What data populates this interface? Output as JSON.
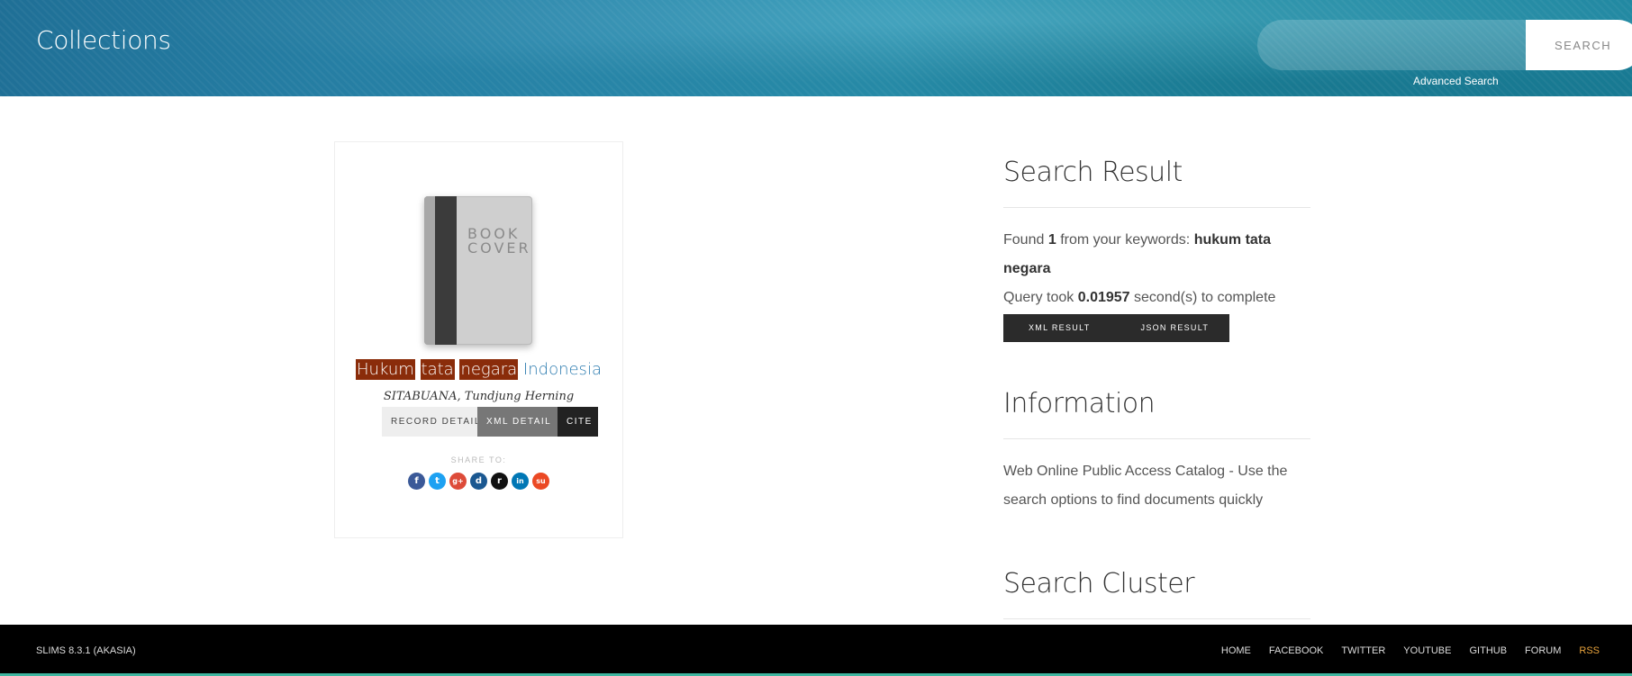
{
  "header": {
    "title": "Collections",
    "search_placeholder": "",
    "search_button": "SEARCH",
    "advanced_search": "Advanced Search"
  },
  "result": {
    "cover_text_line1": "BOOK",
    "cover_text_line2": "COVER",
    "title_highlights": [
      "Hukum",
      "tata",
      "negara"
    ],
    "title_rest": "Indonesia",
    "author": "SITABUANA, Tundjung Herning",
    "buttons": {
      "record_detail": "RECORD DETAIL",
      "xml_detail": "XML DETAIL",
      "cite": "CITE"
    },
    "share_label": "SHARE TO:",
    "share_icons": [
      {
        "name": "facebook-icon",
        "glyph": "f",
        "color": "#3b5998"
      },
      {
        "name": "twitter-icon",
        "glyph": "t",
        "color": "#1da1f2"
      },
      {
        "name": "google-plus-icon",
        "glyph": "g+",
        "color": "#dd4b39"
      },
      {
        "name": "digg-icon",
        "glyph": "d",
        "color": "#1b5891"
      },
      {
        "name": "reddit-icon",
        "glyph": "r",
        "color": "#111111"
      },
      {
        "name": "linkedin-icon",
        "glyph": "in",
        "color": "#0077b5"
      },
      {
        "name": "stumbleupon-icon",
        "glyph": "su",
        "color": "#eb4924"
      }
    ]
  },
  "sidebar": {
    "search_result": {
      "heading": "Search Result",
      "found_prefix": "Found",
      "found_count": "1",
      "found_middle": "from your keywords:",
      "keywords": "hukum tata negara",
      "query_prefix": "Query took",
      "query_time": "0.01957",
      "query_suffix": "second(s) to complete",
      "xml_result": "XML RESULT",
      "json_result": "JSON RESULT"
    },
    "information": {
      "heading": "Information",
      "text": "Web Online Public Access Catalog - Use the search options to find documents quickly"
    },
    "search_cluster": {
      "heading": "Search Cluster"
    }
  },
  "footer": {
    "version": "SLIMS 8.3.1 (AKASIA)",
    "links": [
      "HOME",
      "FACEBOOK",
      "TWITTER",
      "YOUTUBE",
      "GITHUB",
      "FORUM",
      "RSS"
    ]
  }
}
